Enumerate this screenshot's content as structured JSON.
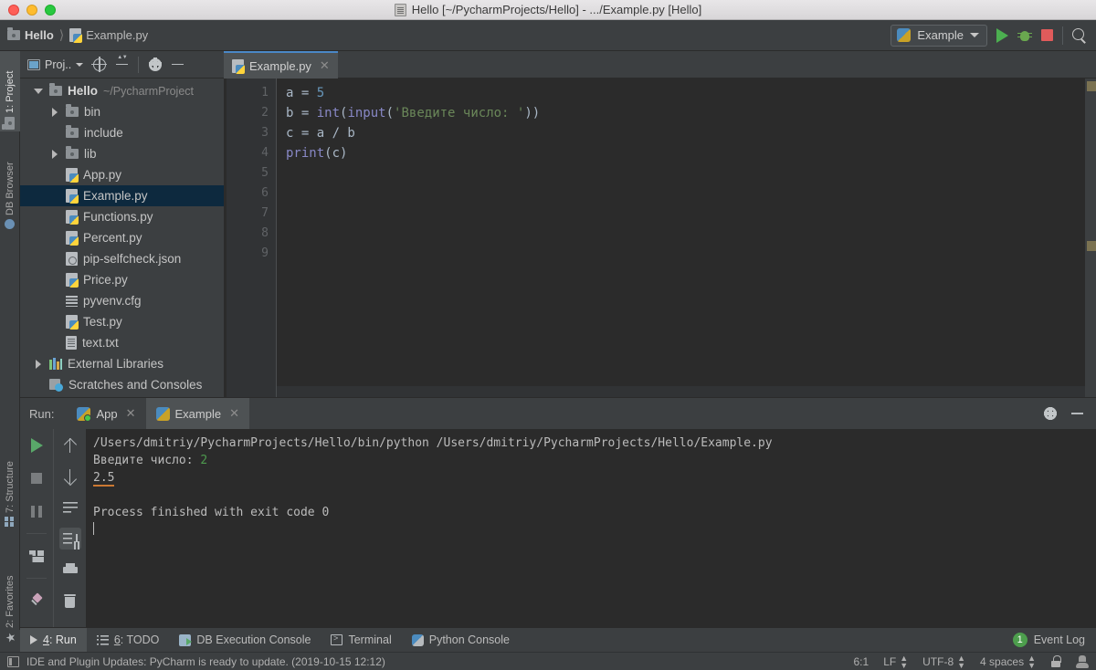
{
  "window": {
    "title": "Hello [~/PycharmProjects/Hello] - .../Example.py [Hello]"
  },
  "breadcrumb": {
    "project": "Hello",
    "file": "Example.py"
  },
  "toolbar": {
    "run_config": "Example",
    "run_label": "Run",
    "debug_label": "Debug",
    "stop_label": "Stop",
    "search_label": "Search Everywhere"
  },
  "left_strip": {
    "project_tab": "1: Project",
    "db_browser_tab": "DB Browser",
    "structure_tab": "7: Structure",
    "favorites_tab": "2: Favorites"
  },
  "project_panel": {
    "title": "Proj..",
    "tree": [
      {
        "label": "Hello",
        "path": "~/PycharmProject",
        "indent": 0,
        "twist": "open",
        "icon": "folder-icon",
        "bold": true,
        "selected": false
      },
      {
        "label": "bin",
        "path": "",
        "indent": 1,
        "twist": "closed",
        "icon": "folder-icon",
        "bold": false,
        "selected": false
      },
      {
        "label": "include",
        "path": "",
        "indent": 1,
        "twist": "none",
        "icon": "folder-icon",
        "bold": false,
        "selected": false
      },
      {
        "label": "lib",
        "path": "",
        "indent": 1,
        "twist": "closed",
        "icon": "folder-icon",
        "bold": false,
        "selected": false
      },
      {
        "label": "App.py",
        "path": "",
        "indent": 1,
        "twist": "none",
        "icon": "python-file-icon",
        "bold": false,
        "selected": false
      },
      {
        "label": "Example.py",
        "path": "",
        "indent": 1,
        "twist": "none",
        "icon": "python-file-icon",
        "bold": false,
        "selected": true
      },
      {
        "label": "Functions.py",
        "path": "",
        "indent": 1,
        "twist": "none",
        "icon": "python-file-icon",
        "bold": false,
        "selected": false
      },
      {
        "label": "Percent.py",
        "path": "",
        "indent": 1,
        "twist": "none",
        "icon": "python-file-icon",
        "bold": false,
        "selected": false
      },
      {
        "label": "pip-selfcheck.json",
        "path": "",
        "indent": 1,
        "twist": "none",
        "icon": "json-file-icon",
        "bold": false,
        "selected": false
      },
      {
        "label": "Price.py",
        "path": "",
        "indent": 1,
        "twist": "none",
        "icon": "python-file-icon",
        "bold": false,
        "selected": false
      },
      {
        "label": "pyvenv.cfg",
        "path": "",
        "indent": 1,
        "twist": "none",
        "icon": "config-file-icon",
        "bold": false,
        "selected": false
      },
      {
        "label": "Test.py",
        "path": "",
        "indent": 1,
        "twist": "none",
        "icon": "python-file-icon",
        "bold": false,
        "selected": false
      },
      {
        "label": "text.txt",
        "path": "",
        "indent": 1,
        "twist": "none",
        "icon": "text-file-icon",
        "bold": false,
        "selected": false
      },
      {
        "label": "External Libraries",
        "path": "",
        "indent": 0,
        "twist": "closed",
        "icon": "libraries-icon",
        "bold": false,
        "selected": false
      },
      {
        "label": "Scratches and Consoles",
        "path": "",
        "indent": 0,
        "twist": "none",
        "icon": "scratches-icon",
        "bold": false,
        "selected": false
      }
    ]
  },
  "editor": {
    "tab": "Example.py",
    "line_numbers": [
      "1",
      "2",
      "3",
      "4",
      "5",
      "6",
      "7",
      "8",
      "9"
    ],
    "lines": [
      {
        "n": 1,
        "tokens": [
          {
            "t": "a = ",
            "c": "def"
          },
          {
            "t": "5",
            "c": "num"
          }
        ]
      },
      {
        "n": 2,
        "tokens": [
          {
            "t": "b = ",
            "c": "def"
          },
          {
            "t": "int",
            "c": "fn"
          },
          {
            "t": "(",
            "c": "def"
          },
          {
            "t": "input",
            "c": "fn"
          },
          {
            "t": "(",
            "c": "def"
          },
          {
            "t": "'Введите число: '",
            "c": "str"
          },
          {
            "t": "))",
            "c": "def"
          }
        ]
      },
      {
        "n": 3,
        "tokens": [
          {
            "t": "c = a / b",
            "c": "def"
          }
        ]
      },
      {
        "n": 4,
        "tokens": [
          {
            "t": "print",
            "c": "fn"
          },
          {
            "t": "(c)",
            "c": "def"
          }
        ]
      }
    ]
  },
  "run_panel": {
    "label": "Run:",
    "tabs": [
      {
        "label": "App",
        "active": false,
        "running": true
      },
      {
        "label": "Example",
        "active": true,
        "running": false
      }
    ],
    "console": {
      "command": "/Users/dmitriy/PycharmProjects/Hello/bin/python /Users/dmitriy/PycharmProjects/Hello/Example.py",
      "prompt": "Введите число: ",
      "input_value": "2",
      "result": "2.5",
      "exit_message": "Process finished with exit code 0"
    },
    "tools": {
      "rerun": "Rerun",
      "stop": "Stop",
      "pause": "Pause Output",
      "layout": "Layout Settings",
      "pin": "Pin Tab",
      "up": "Up the Stack Trace",
      "down": "Down the Stack Trace",
      "soft_wrap": "Soft-Wrap",
      "scroll_end": "Scroll to the end",
      "print": "Print",
      "clear": "Clear All",
      "settings": "Settings",
      "hide": "Hide"
    }
  },
  "bottom_tabs": [
    {
      "key": "4",
      "label": ": Run",
      "active": true,
      "icon": "run-icon"
    },
    {
      "key": "6",
      "label": ": TODO",
      "active": false,
      "icon": "todo-icon"
    },
    {
      "key": "",
      "label": "DB Execution Console",
      "active": false,
      "icon": "db-console-icon"
    },
    {
      "key": "",
      "label": "Terminal",
      "active": false,
      "icon": "terminal-icon"
    },
    {
      "key": "",
      "label": "Python Console",
      "active": false,
      "icon": "python-console-icon"
    }
  ],
  "event_log": {
    "count": "1",
    "label": "Event Log"
  },
  "status_bar": {
    "message": "IDE and Plugin Updates: PyCharm is ready to update. (2019-10-15 12:12)",
    "position": "6:1",
    "line_separator": "LF",
    "encoding": "UTF-8",
    "indent": "4 spaces"
  },
  "colors": {
    "accent_blue": "#4a88c7",
    "selection": "#0d293e",
    "panel_bg": "#3c3f41",
    "editor_bg": "#2b2b2b",
    "run_green": "#59a869",
    "stop_red": "#e05b5b",
    "string_green": "#6a8759",
    "number_blue": "#6897bb",
    "link_orange": "#cc7832"
  }
}
